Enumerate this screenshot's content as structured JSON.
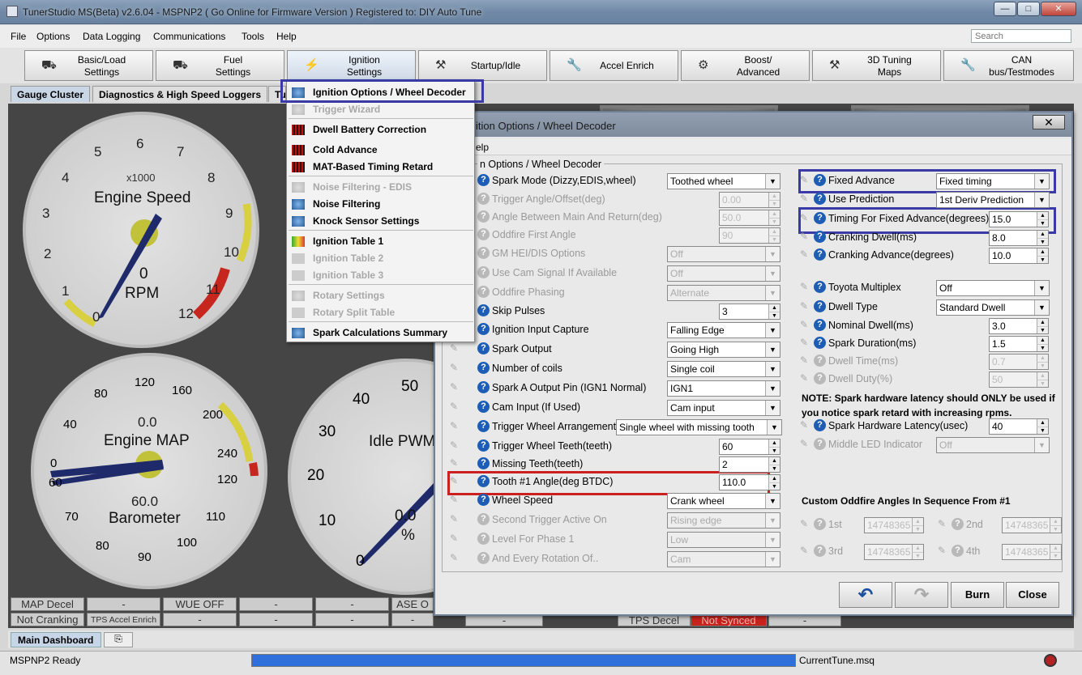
{
  "window": {
    "title": "TunerStudio MS(Beta) v2.6.04 - MSPNP2 ( Go Online for Firmware Version ) Registered to: DIY Auto Tune",
    "min": "—",
    "max": "□",
    "close": "✕"
  },
  "menubar": {
    "items": [
      "File",
      "Options",
      "Data Logging",
      "Communications",
      "Tools",
      "Help"
    ],
    "search_placeholder": "Search"
  },
  "toolbar": {
    "buttons": [
      {
        "line1": "Basic/Load",
        "line2": "Settings"
      },
      {
        "line1": "Fuel",
        "line2": "Settings"
      },
      {
        "line1": "Ignition",
        "line2": "Settings"
      },
      {
        "line1": "Startup/Idle",
        "line2": ""
      },
      {
        "line1": "Accel Enrich",
        "line2": ""
      },
      {
        "line1": "Boost/",
        "line2": "Advanced"
      },
      {
        "line1": "3D Tuning",
        "line2": "Maps"
      },
      {
        "line1": "CAN",
        "line2": "bus/Testmodes"
      }
    ]
  },
  "tabs": [
    "Gauge Cluster",
    "Diagnostics & High Speed Loggers",
    "Tu"
  ],
  "gauges": {
    "engine_speed": {
      "title": "Engine Speed",
      "subtitle": "x1000",
      "value": "0",
      "unit": "RPM",
      "ticks": [
        "0",
        "1",
        "2",
        "3",
        "4",
        "5",
        "6",
        "7",
        "8",
        "9",
        "10",
        "11",
        "12"
      ]
    },
    "engine_map": {
      "title": "Engine MAP",
      "value": "0.0",
      "sub_title": "Barometer",
      "sub_value": "60.0",
      "ticks": [
        "0",
        "40",
        "80",
        "120",
        "160",
        "200",
        "240"
      ],
      "sub_ticks": [
        "60",
        "70",
        "80",
        "90",
        "100",
        "110",
        "120"
      ]
    },
    "idle_pwm": {
      "title": "Idle PWM",
      "value": "0.0",
      "unit": "%",
      "ticks": [
        "0",
        "10",
        "20",
        "30",
        "40",
        "50"
      ]
    }
  },
  "status_indicators": {
    "row1": [
      "MAP Decel",
      "-",
      "WUE OFF",
      "-",
      "-",
      "ASE O"
    ],
    "row2": [
      "Not Cranking",
      "TPS Accel Enrich",
      "-",
      "-",
      "-",
      "-",
      "-",
      "TPS Decel",
      "Not Synced",
      "-"
    ]
  },
  "bottom_tabs": [
    "Main Dashboard"
  ],
  "statusbar": {
    "left": "MSPNP2 Ready",
    "file": "CurrentTune.msq"
  },
  "dropdown": {
    "items": [
      {
        "label": "Ignition Options / Wheel Decoder",
        "disabled": false
      },
      {
        "label": "Trigger Wizard",
        "disabled": true
      },
      {
        "label": "Dwell Battery Correction",
        "disabled": false
      },
      {
        "label": "Cold Advance",
        "disabled": false
      },
      {
        "label": "MAT-Based Timing Retard",
        "disabled": false
      },
      {
        "label": "Noise Filtering - EDIS",
        "disabled": true
      },
      {
        "label": "Noise Filtering",
        "disabled": false
      },
      {
        "label": "Knock Sensor Settings",
        "disabled": false
      },
      {
        "label": "Ignition Table 1",
        "disabled": false
      },
      {
        "label": "Ignition Table 2",
        "disabled": true
      },
      {
        "label": "Ignition Table 3",
        "disabled": true
      },
      {
        "label": "Rotary Settings",
        "disabled": true
      },
      {
        "label": "Rotary Split Table",
        "disabled": true
      },
      {
        "label": "Spark Calculations Summary",
        "disabled": false
      }
    ]
  },
  "dialog": {
    "title": "ition Options / Wheel Decoder",
    "menu": "elp",
    "group_title": "n Options / Wheel Decoder",
    "left_fields": [
      {
        "label": "Spark Mode (Dizzy,EDIS,wheel)",
        "type": "select",
        "value": "Toothed wheel",
        "disabled": false
      },
      {
        "label": "Trigger Angle/Offset(deg)",
        "type": "spin",
        "value": "0.00",
        "disabled": true
      },
      {
        "label": "Angle Between Main And Return(deg)",
        "type": "spin",
        "value": "50.0",
        "disabled": true
      },
      {
        "label": "Oddfire First Angle",
        "type": "spin",
        "value": "90",
        "disabled": true
      },
      {
        "label": "GM HEI/DIS Options",
        "type": "select",
        "value": "Off",
        "disabled": true
      },
      {
        "label": "Use Cam Signal If Available",
        "type": "select",
        "value": "Off",
        "disabled": true
      },
      {
        "label": "Oddfire Phasing",
        "type": "select",
        "value": "Alternate",
        "disabled": true
      },
      {
        "label": "Skip Pulses",
        "type": "spin",
        "value": "3",
        "disabled": false
      },
      {
        "label": "Ignition Input Capture",
        "type": "select",
        "value": "Falling Edge",
        "disabled": false
      },
      {
        "label": "Spark Output",
        "type": "select",
        "value": "Going High",
        "disabled": false
      },
      {
        "label": "Number of coils",
        "type": "select",
        "value": "Single coil",
        "disabled": false
      },
      {
        "label": "Spark A Output Pin (IGN1 Normal)",
        "type": "select",
        "value": "IGN1",
        "disabled": false
      },
      {
        "label": "Cam Input (If Used)",
        "type": "select",
        "value": "Cam input",
        "disabled": false
      },
      {
        "label": "Trigger Wheel Arrangement",
        "type": "select",
        "value": "Single wheel with missing tooth",
        "disabled": false
      },
      {
        "label": "Trigger Wheel Teeth(teeth)",
        "type": "spin",
        "value": "60",
        "disabled": false
      },
      {
        "label": "Missing Teeth(teeth)",
        "type": "spin",
        "value": "2",
        "disabled": false
      },
      {
        "label": "Tooth #1 Angle(deg BTDC)",
        "type": "spin",
        "value": "110.0",
        "disabled": false
      },
      {
        "label": "Wheel Speed",
        "type": "select",
        "value": "Crank wheel",
        "disabled": false
      },
      {
        "label": "Second Trigger Active On",
        "type": "select",
        "value": "Rising edge",
        "disabled": true
      },
      {
        "label": "Level For Phase 1",
        "type": "select",
        "value": "Low",
        "disabled": true
      },
      {
        "label": "And Every Rotation Of..",
        "type": "select",
        "value": "Cam",
        "disabled": true
      }
    ],
    "right_fields": [
      {
        "label": "Fixed Advance",
        "type": "select",
        "value": "Fixed timing",
        "disabled": false
      },
      {
        "label": "Use Prediction",
        "type": "select",
        "value": "1st Deriv Prediction",
        "disabled": false
      },
      {
        "label": "Timing For Fixed Advance(degrees)",
        "type": "spin",
        "value": "15.0",
        "disabled": false
      },
      {
        "label": "Cranking Dwell(ms)",
        "type": "spin",
        "value": "8.0",
        "disabled": false
      },
      {
        "label": "Cranking Advance(degrees)",
        "type": "spin",
        "value": "10.0",
        "disabled": false
      },
      {
        "label": "Toyota Multiplex",
        "type": "select",
        "value": "Off",
        "disabled": false
      },
      {
        "label": "Dwell Type",
        "type": "select",
        "value": "Standard Dwell",
        "disabled": false
      },
      {
        "label": "Nominal Dwell(ms)",
        "type": "spin",
        "value": "3.0",
        "disabled": false
      },
      {
        "label": "Spark Duration(ms)",
        "type": "spin",
        "value": "1.5",
        "disabled": false
      },
      {
        "label": "Dwell Time(ms)",
        "type": "spin",
        "value": "0.7",
        "disabled": true
      },
      {
        "label": "Dwell Duty(%)",
        "type": "spin",
        "value": "50",
        "disabled": true
      },
      {
        "label": "Spark Hardware Latency(usec)",
        "type": "spin",
        "value": "40",
        "disabled": false
      },
      {
        "label": "Middle LED Indicator",
        "type": "select",
        "value": "Off",
        "disabled": true
      }
    ],
    "note": "NOTE: Spark hardware latency should ONLY be used if you notice spark retard with increasing rpms.",
    "oddfire_title": "Custom Oddfire Angles In Sequence From #1",
    "oddfire": [
      {
        "label": "1st",
        "value": "14748365"
      },
      {
        "label": "2nd",
        "value": "14748365"
      },
      {
        "label": "3rd",
        "value": "14748365"
      },
      {
        "label": "4th",
        "value": "14748365"
      }
    ],
    "buttons": {
      "burn": "Burn",
      "close": "Close"
    }
  }
}
